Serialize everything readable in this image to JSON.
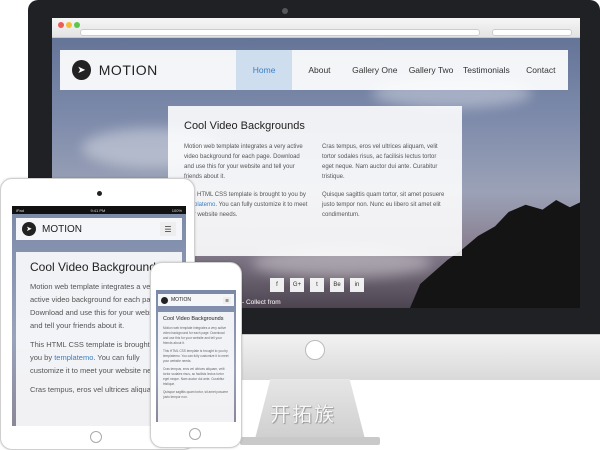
{
  "brand": {
    "name": "MOTION",
    "watermark": "开拓族"
  },
  "nav": {
    "items": [
      {
        "label": "Home",
        "active": true
      },
      {
        "label": "About",
        "active": false
      },
      {
        "label": "Gallery One",
        "active": false
      },
      {
        "label": "Gallery Two",
        "active": false
      },
      {
        "label": "Testimonials",
        "active": false
      },
      {
        "label": "Contact",
        "active": false
      }
    ]
  },
  "hero": {
    "title": "Cool Video Backgrounds",
    "col1_p1": "Motion web template integrates a very active video background for each page. Download and use this for your website and tell your friends about it.",
    "col1_p2_prefix": "This HTML CSS template is brought to you by ",
    "col1_p2_link": "templatemo",
    "col1_p2_suffix": ". You can fully customize it to meet your website needs.",
    "col2_p1": "Cras tempus, eros vel ultrices aliquam, velit tortor sodales risus, ac facilisis lectus tortor eget neque. Nam auctor dui ante. Curabitur tristique.",
    "col2_p2": "Quisque sagittis quam tortor, sit amet posuere justo tempor non. Nunc eu libero sit amet elit condimentum."
  },
  "social": [
    "f",
    "G+",
    "t",
    "Be",
    "in"
  ],
  "footer": {
    "credit": "- Collect from"
  },
  "tablet": {
    "status_left": "iPad",
    "status_time": "9:41 PM",
    "status_right": "100%",
    "menu_label": "☰",
    "title": "Cool Video Backgrounds",
    "p1": "Motion web template integrates a very active video background for each page. Download and use this for your website and tell your friends about it.",
    "p2_prefix": "This HTML CSS template is brought to you by ",
    "p2_link": "templatemo",
    "p2_suffix": ". You can fully customize it to meet your website needs.",
    "p3": "Cras tempus, eros vel ultrices aliquam,"
  },
  "phone": {
    "title": "Cool Video Backgrounds",
    "p1": "Motion web template integrates a very active video background for each page. Download and use this for your website and tell your friends about it.",
    "p2": "This HTML CSS template is brought to you by templatemo. You can fully customize it to meet your website needs.",
    "p3": "Cras tempus, eros vel ultrices aliquam, velit tortor sodales risus, ac facilisis lectus tortor eget neque. Nam auctor dui ante. Curabitur tristique.",
    "p4": "Quisque sagittis quam tortor, sit amet posuere justo tempor non."
  },
  "colors": {
    "accent": "#3b7ec0",
    "dark": "#1f2124"
  }
}
